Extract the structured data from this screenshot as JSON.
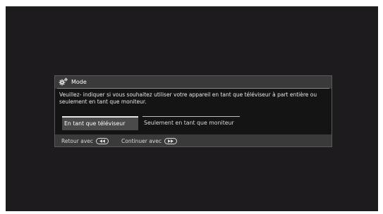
{
  "dialog": {
    "title": "Mode",
    "icon": "gear-icon",
    "message": "Veuillez- indiquer si vous souhaitez utiliser votre appareil en tant que téléviseur à part entière ou seulement en tant que moniteur.",
    "options": [
      {
        "label": "En tant que téléviseur",
        "selected": true
      },
      {
        "label": "Seulement en tant que moniteur",
        "selected": false
      }
    ],
    "footer": {
      "back_label": "Retour avec",
      "back_icon": "rewind-button-icon",
      "continue_label": "Continuer avec",
      "continue_icon": "fast-forward-button-icon"
    }
  },
  "colors": {
    "screen_bg": "#1d1b1e",
    "dialog_bg": "#3a3a3a",
    "body_bg": "#141414",
    "selected_bg": "#4a4a4a",
    "text": "#f0f0f0"
  }
}
